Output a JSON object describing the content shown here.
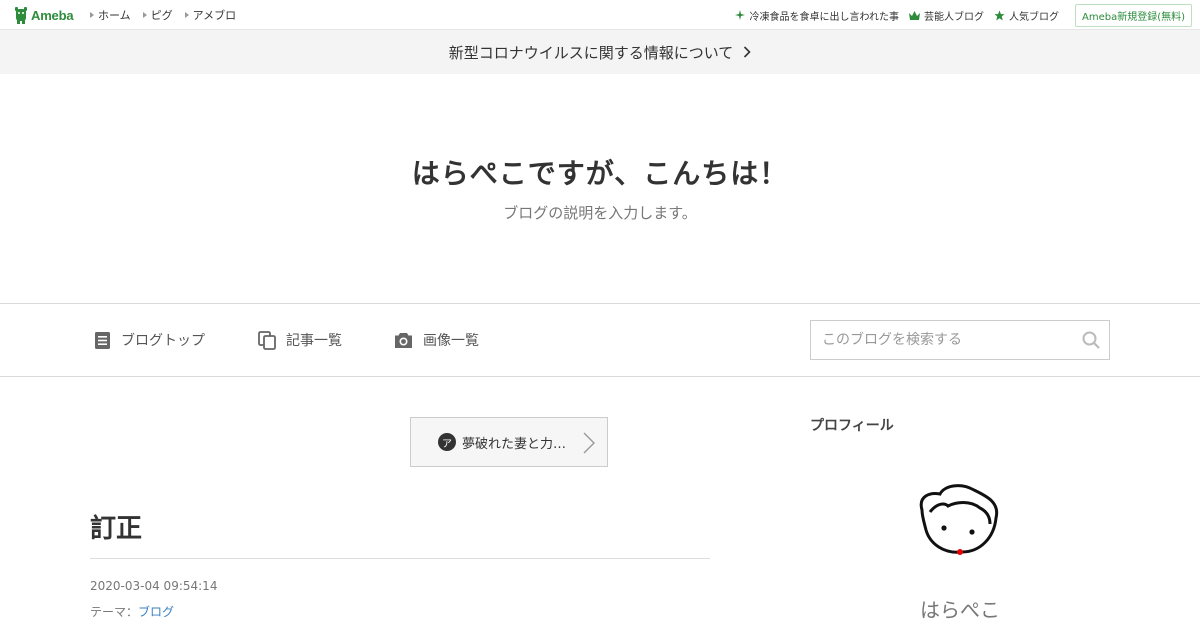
{
  "header": {
    "logo_text": "Ameba",
    "nav": [
      "ホーム",
      "ピグ",
      "アメブロ"
    ],
    "right_links": [
      {
        "label": "冷凍食品を食卓に出し言われた事",
        "icon": "sparkle-icon"
      },
      {
        "label": "芸能人ブログ",
        "icon": "crown-icon"
      },
      {
        "label": "人気ブログ",
        "icon": "star-icon"
      }
    ],
    "register_label": "Ameba新規登録(無料)"
  },
  "notice": {
    "text": "新型コロナウイルスに関する情報について"
  },
  "blog": {
    "title": "はらぺこですが、こんちは！",
    "description": "ブログの説明を入力します。"
  },
  "global_nav": {
    "items": [
      {
        "label": "ブログトップ",
        "icon": "document-icon"
      },
      {
        "label": "記事一覧",
        "icon": "copy-icon"
      },
      {
        "label": "画像一覧",
        "icon": "camera-icon"
      }
    ],
    "search_placeholder": "このブログを検索する"
  },
  "pager": {
    "badge": "ア",
    "label": "夢破れた妻と力…"
  },
  "entry": {
    "title": "訂正",
    "date": "2020-03-04 09:54:14",
    "theme_label": "テーマ：",
    "theme_link": "ブログ"
  },
  "sidebar": {
    "profile_heading": "プロフィール",
    "profile_name": "はらぺこ"
  },
  "colors": {
    "brand_green": "#2d8c3c",
    "link_blue": "#3a7fc1",
    "notice_bg": "#f4f4f4"
  }
}
